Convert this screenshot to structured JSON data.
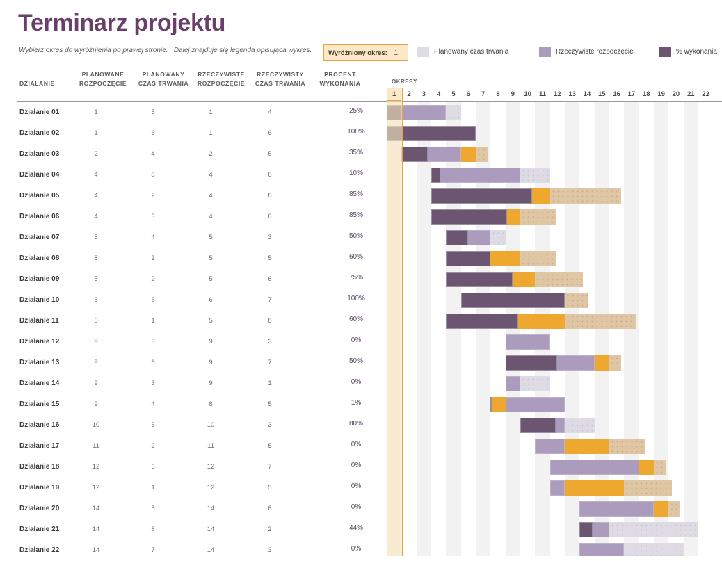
{
  "header": {
    "title": "Terminarz projektu",
    "subtitle": "Wybierz okres do wyróżnienia po prawej stronie.   Dalej znajduje się legenda opisująca wykres.",
    "highlight_box": {
      "label": "Wyróżniony okres:",
      "value": "1"
    }
  },
  "legend": {
    "items": [
      {
        "label": "Planowany czas trwania",
        "color": "#dedbe4",
        "swatch": "plan-swatch"
      },
      {
        "label": "Rzeczywiste rozpoczęcie",
        "color": "#ab9cbd",
        "swatch": "actual-swatch"
      },
      {
        "label": "% wykonania",
        "color": "#6b5570",
        "swatch": "complete-swatch"
      }
    ]
  },
  "table": {
    "columns": [
      {
        "line1": "DZIAŁANIE",
        "line2": ""
      },
      {
        "line1": "PLANOWANE",
        "line2": "ROZPOCZĘCIE"
      },
      {
        "line1": "PLANOWANY",
        "line2": "CZAS TRWANIA"
      },
      {
        "line1": "RZECZYWISTE",
        "line2": "ROZPOCZĘCIE"
      },
      {
        "line1": "RZECZYWISTY",
        "line2": "CZAS TRWANIA"
      },
      {
        "line1": "PROCENT",
        "line2": "WYKONANIA"
      }
    ],
    "rows": [
      {
        "task": "Działanie 01",
        "plan_start": 1,
        "plan_dur": 5,
        "act_start": 1,
        "act_dur": 4,
        "pct": "25%"
      },
      {
        "task": "Działanie 02",
        "plan_start": 1,
        "plan_dur": 6,
        "act_start": 1,
        "act_dur": 6,
        "pct": "100%"
      },
      {
        "task": "Działanie 03",
        "plan_start": 2,
        "plan_dur": 4,
        "act_start": 2,
        "act_dur": 5,
        "pct": "35%"
      },
      {
        "task": "Działanie 04",
        "plan_start": 4,
        "plan_dur": 8,
        "act_start": 4,
        "act_dur": 6,
        "pct": "10%"
      },
      {
        "task": "Działanie 05",
        "plan_start": 4,
        "plan_dur": 2,
        "act_start": 4,
        "act_dur": 8,
        "pct": "85%"
      },
      {
        "task": "Działanie 06",
        "plan_start": 4,
        "plan_dur": 3,
        "act_start": 4,
        "act_dur": 6,
        "pct": "85%"
      },
      {
        "task": "Działanie 07",
        "plan_start": 5,
        "plan_dur": 4,
        "act_start": 5,
        "act_dur": 3,
        "pct": "50%"
      },
      {
        "task": "Działanie 08",
        "plan_start": 5,
        "plan_dur": 2,
        "act_start": 5,
        "act_dur": 5,
        "pct": "60%"
      },
      {
        "task": "Działanie 09",
        "plan_start": 5,
        "plan_dur": 2,
        "act_start": 5,
        "act_dur": 6,
        "pct": "75%"
      },
      {
        "task": "Działanie 10",
        "plan_start": 6,
        "plan_dur": 5,
        "act_start": 6,
        "act_dur": 7,
        "pct": "100%"
      },
      {
        "task": "Działanie 11",
        "plan_start": 6,
        "plan_dur": 1,
        "act_start": 5,
        "act_dur": 8,
        "pct": "60%"
      },
      {
        "task": "Działanie 12",
        "plan_start": 9,
        "plan_dur": 3,
        "act_start": 9,
        "act_dur": 3,
        "pct": "0%"
      },
      {
        "task": "Działanie 13",
        "plan_start": 9,
        "plan_dur": 6,
        "act_start": 9,
        "act_dur": 7,
        "pct": "50%"
      },
      {
        "task": "Działanie 14",
        "plan_start": 9,
        "plan_dur": 3,
        "act_start": 9,
        "act_dur": 1,
        "pct": "0%"
      },
      {
        "task": "Działanie 15",
        "plan_start": 9,
        "plan_dur": 4,
        "act_start": 8,
        "act_dur": 5,
        "pct": "1%"
      },
      {
        "task": "Działanie 16",
        "plan_start": 10,
        "plan_dur": 5,
        "act_start": 10,
        "act_dur": 3,
        "pct": "80%"
      },
      {
        "task": "Działanie 17",
        "plan_start": 11,
        "plan_dur": 2,
        "act_start": 11,
        "act_dur": 5,
        "pct": "0%"
      },
      {
        "task": "Działanie 18",
        "plan_start": 12,
        "plan_dur": 6,
        "act_start": 12,
        "act_dur": 7,
        "pct": "0%"
      },
      {
        "task": "Działanie 19",
        "plan_start": 12,
        "plan_dur": 1,
        "act_start": 12,
        "act_dur": 5,
        "pct": "0%"
      },
      {
        "task": "Działanie 20",
        "plan_start": 14,
        "plan_dur": 5,
        "act_start": 14,
        "act_dur": 6,
        "pct": "0%"
      },
      {
        "task": "Działanie 21",
        "plan_start": 14,
        "plan_dur": 8,
        "act_start": 14,
        "act_dur": 2,
        "pct": "44%"
      },
      {
        "task": "Działanie 22",
        "plan_start": 14,
        "plan_dur": 7,
        "act_start": 14,
        "act_dur": 3,
        "pct": "0%"
      }
    ]
  },
  "gantt": {
    "periods_label": "OKRESY",
    "periods": [
      1,
      2,
      3,
      4,
      5,
      6,
      7,
      8,
      9,
      10,
      11,
      12,
      13,
      14,
      15,
      16,
      17,
      18,
      19,
      20,
      21,
      22
    ],
    "highlighted_period": 1,
    "colors": {
      "complete": "#6b5570",
      "actual": "#ab9cbd",
      "planned": "#dedbe4",
      "overrun": "#efa82f",
      "overrun_planned": "#dfc6a4",
      "highlight": "#fae8c8",
      "highlight_border": "#e8a33d",
      "title": "#6a3f6b"
    }
  },
  "chart_data": {
    "type": "bar",
    "title": "Terminarz projektu",
    "xlabel": "OKRESY",
    "ylabel": "DZIAŁANIE",
    "xlim": [
      1,
      22
    ],
    "grid": true,
    "legend_position": "top-right",
    "categories": [
      "Działanie 01",
      "Działanie 02",
      "Działanie 03",
      "Działanie 04",
      "Działanie 05",
      "Działanie 06",
      "Działanie 07",
      "Działanie 08",
      "Działanie 09",
      "Działanie 10",
      "Działanie 11",
      "Działanie 12",
      "Działanie 13",
      "Działanie 14",
      "Działanie 15",
      "Działanie 16",
      "Działanie 17",
      "Działanie 18",
      "Działanie 19",
      "Działanie 20",
      "Działanie 21",
      "Działanie 22"
    ],
    "series": [
      {
        "name": "PLANOWANE ROZPOCZĘCIE",
        "values": [
          1,
          1,
          2,
          4,
          4,
          4,
          5,
          5,
          5,
          6,
          6,
          9,
          9,
          9,
          9,
          10,
          11,
          12,
          12,
          14,
          14,
          14
        ]
      },
      {
        "name": "PLANOWANY CZAS TRWANIA",
        "values": [
          5,
          6,
          4,
          8,
          2,
          3,
          4,
          2,
          2,
          5,
          1,
          3,
          6,
          3,
          4,
          5,
          2,
          6,
          1,
          5,
          8,
          7
        ]
      },
      {
        "name": "RZECZYWISTE ROZPOCZĘCIE",
        "values": [
          1,
          1,
          2,
          4,
          4,
          4,
          5,
          5,
          5,
          6,
          5,
          9,
          9,
          9,
          8,
          10,
          11,
          12,
          12,
          14,
          14,
          14
        ]
      },
      {
        "name": "RZECZYWISTY CZAS TRWANIA",
        "values": [
          4,
          6,
          5,
          6,
          8,
          6,
          3,
          5,
          6,
          7,
          8,
          3,
          7,
          1,
          5,
          3,
          5,
          7,
          5,
          6,
          2,
          3
        ]
      },
      {
        "name": "PROCENT WYKONANIA",
        "values": [
          25,
          100,
          35,
          10,
          85,
          85,
          50,
          60,
          75,
          100,
          60,
          0,
          50,
          0,
          1,
          80,
          0,
          0,
          0,
          0,
          44,
          0
        ]
      }
    ]
  }
}
